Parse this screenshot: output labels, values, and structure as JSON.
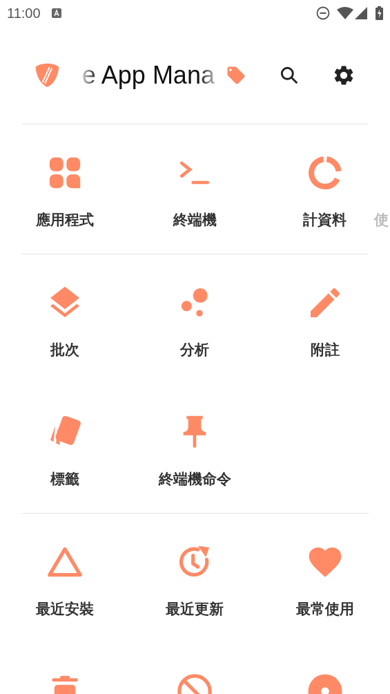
{
  "status_bar": {
    "time": "11:00"
  },
  "header": {
    "title": "e App Mana"
  },
  "sections": [
    {
      "items": [
        {
          "kind": "apps",
          "label": "應用程式"
        },
        {
          "kind": "terminal",
          "label": "終端機"
        },
        {
          "kind": "donut",
          "label": "計資料",
          "label_tail": "使"
        }
      ]
    },
    {
      "items": [
        {
          "kind": "layers",
          "label": "批次"
        },
        {
          "kind": "bubbles",
          "label": "分析"
        },
        {
          "kind": "pencil",
          "label": "附註"
        },
        {
          "kind": "tags",
          "label": "標籤"
        },
        {
          "kind": "pin",
          "label": "終端機命令"
        }
      ]
    },
    {
      "items": [
        {
          "kind": "triangle",
          "label": "最近安裝"
        },
        {
          "kind": "history",
          "label": "最近更新"
        },
        {
          "kind": "heart",
          "label": "最常使用"
        },
        {
          "kind": "trash"
        },
        {
          "kind": "block"
        },
        {
          "kind": "disc"
        }
      ]
    }
  ]
}
